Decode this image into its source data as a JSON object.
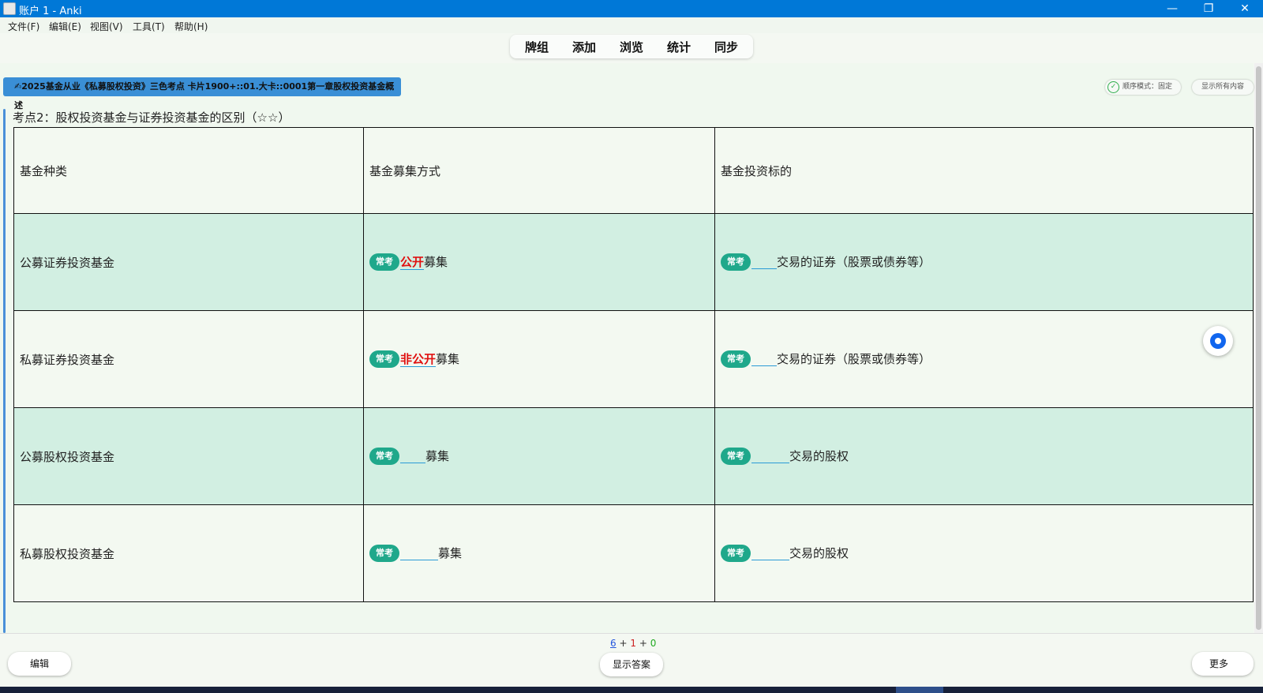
{
  "window": {
    "title": "账户 1 - Anki",
    "minimize": "—",
    "restore": "❐",
    "close": "✕"
  },
  "menu": [
    "文件(F)",
    "编辑(E)",
    "视图(V)",
    "工具(T)",
    "帮助(H)"
  ],
  "toolbar": [
    "牌组",
    "添加",
    "浏览",
    "统计",
    "同步"
  ],
  "deck_banner": "✍2025基金从业《私募股权投资》三色考点 卡片1900+::01.大卡::0001第一章股权投资基金概述",
  "order_mode": "顺序模式：固定",
  "show_all": "显示所有内容",
  "card": {
    "heading": "考点2：股权投资基金与证券投资基金的区别（☆☆）",
    "tag": "常考",
    "header": [
      "基金种类",
      "基金募集方式",
      "基金投资标的"
    ],
    "rows": [
      {
        "type": "公募证券投资基金",
        "method_answer": "公开",
        "method_suffix": "募集",
        "target_suffix": "交易的证券（股票或债券等）"
      },
      {
        "type": "私募证券投资基金",
        "method_answer": "非公开",
        "method_suffix": "募集",
        "target_suffix": "交易的证券（股票或债券等）"
      },
      {
        "type": "公募股权投资基金",
        "method_suffix": "募集",
        "target_suffix": "交易的股权"
      },
      {
        "type": "私募股权投资基金",
        "method_suffix": "募集",
        "target_suffix": "交易的股权"
      }
    ]
  },
  "counts": {
    "new": "6",
    "learn": "1",
    "review": "0",
    "plus": "+"
  },
  "buttons": {
    "edit": "编辑",
    "show_answer": "显示答案",
    "more": "更多"
  },
  "colors": {
    "tag": "#1fa88b",
    "answer": "#e01010",
    "banner": "#3a8fd6",
    "titlebar": "#0078d7"
  }
}
